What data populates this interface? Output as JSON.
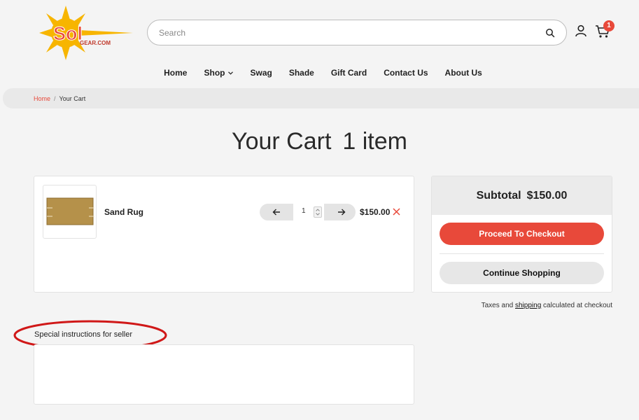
{
  "brand": {
    "logo_text": "Sol",
    "logo_subtext": "GEAR.COM",
    "accent_color": "#e8493a",
    "sun_color": "#f7b500"
  },
  "header": {
    "search": {
      "placeholder": "Search",
      "value": ""
    },
    "icons": [
      "search-icon",
      "account-icon",
      "cart-icon"
    ],
    "cart_count": "1"
  },
  "nav": {
    "items": [
      {
        "label": "Home"
      },
      {
        "label": "Shop",
        "has_dropdown": true
      },
      {
        "label": "Swag"
      },
      {
        "label": "Shade"
      },
      {
        "label": "Gift Card"
      },
      {
        "label": "Contact Us"
      },
      {
        "label": "About Us"
      }
    ]
  },
  "breadcrumb": {
    "home": "Home",
    "separator": "/",
    "current": "Your Cart"
  },
  "page": {
    "title": "Your Cart",
    "item_count": "1 item"
  },
  "cart": {
    "items": [
      {
        "name": "Sand Rug",
        "quantity": "1",
        "price": "$150.00"
      }
    ]
  },
  "summary": {
    "subtotal_label": "Subtotal",
    "subtotal_value": "$150.00",
    "checkout_label": "Proceed To Checkout",
    "continue_label": "Continue Shopping"
  },
  "tax_note": {
    "prefix": "Taxes and",
    "link": "shipping",
    "suffix": "calculated at checkout"
  },
  "instructions": {
    "label": "Special instructions for seller",
    "value": ""
  }
}
